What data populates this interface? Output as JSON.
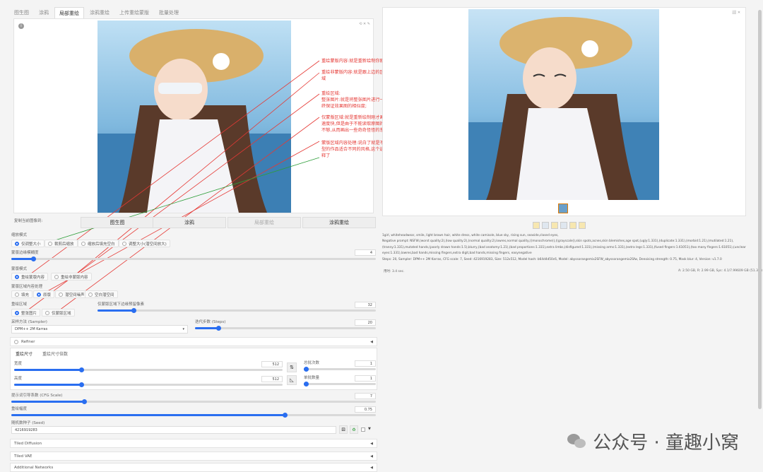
{
  "tabs": [
    "图生图",
    "涂鸦",
    "局部重绘",
    "涂鸦重绘",
    "上传重绘蒙版",
    "批量处理"
  ],
  "copy_label": "复制当前图像到:",
  "copy_buttons": [
    "图生图",
    "涂鸦",
    "局部重绘",
    "涂鸦重绘"
  ],
  "resize_mode": {
    "label": "缩放模式",
    "options": [
      "仅调整大小",
      "裁剪后缩放",
      "缩放后填充空白",
      "调整大小(潜空间放大)"
    ]
  },
  "mask_blur": {
    "label": "蒙版边缘模糊度",
    "value": "4",
    "fraction": 0.06
  },
  "mask_mode": {
    "label": "蒙版模式",
    "options": [
      "重绘蒙版内容",
      "重绘非蒙版内容"
    ]
  },
  "masked_content": {
    "label": "蒙版区域内容处理",
    "options": [
      "填充",
      "原版",
      "潜空间噪声",
      "空白潜空间"
    ]
  },
  "inpaint_area": {
    "label": "重绘区域",
    "options": [
      "整张图片",
      "仅蒙版区域"
    ]
  },
  "padding": {
    "label": "仅蒙版区域下边缘预留像素",
    "value": "32",
    "fraction": 0.13
  },
  "sampler": {
    "label": "采样方法 (Sampler)",
    "value": "DPM++ 2M Karras"
  },
  "steps": {
    "label": "迭代步数 (Steps)",
    "value": "20",
    "fraction": 0.13
  },
  "refiner": "Refiner",
  "size_tabs": [
    "重绘尺寸",
    "重绘尺寸倍数"
  ],
  "width": {
    "label": "宽度",
    "value": "512",
    "fraction": 0.25
  },
  "height": {
    "label": "高度",
    "value": "512",
    "fraction": 0.25
  },
  "batch_count": {
    "label": "总批次数",
    "value": "1",
    "fraction": 0.02
  },
  "batch_size": {
    "label": "单批数量",
    "value": "1",
    "fraction": 0.02
  },
  "cfg": {
    "label": "提示词引导系数 (CFG Scale)",
    "value": "7",
    "fraction": 0.2
  },
  "denoise": {
    "label": "重绘幅度",
    "value": "0.75",
    "fraction": 0.75
  },
  "seed": {
    "label": "随机数种子 (Seed)",
    "value": "4216919283"
  },
  "accordions": [
    "Tiled Diffusion",
    "Tiled VAE",
    "Additional Networks"
  ],
  "annotations": [
    "重绘蒙版内容:就是重新绘制你刚才画笔涂抹的区域",
    "重绘非蒙版内容:就是跟上边的区域反过来,绘制除了刚画以外的其他所有区域",
    "重绘区域:\n整张图片:就是将整张图片进行一次图生图绘制,能够读取原图的整体风格,最终保证效果图的相似度;",
    "仅蒙版区域:就是重新绘制刚才画笔涂抹的区域,与整张图相比,区域小绘制的速度快,但是由于不能读取原图的全貌,只有局部的话,就会造成对图片的认知不够,从而画出一些奇奇怪怪的东西",
    "蒙版区域内容处理:说白了就是不同的风格,这个具体的你自己尝试吧不同类型的作品适合不同的风格,这个选一个最终你满意的即可,这里就不过多的解释了"
  ],
  "output_info": {
    "prompt": "1girl, whiteheadwear, smile, light brown hair, white dress, white camisole, blue sky, rising sun, seaside,closed eyes,",
    "negative": "Negative prompt: NSFW,(worst quality:2),(low quality:2),(normal quality:2),lowres,normal quality,((monochrome)),((grayscale)),skin spots,acnes,skin blemishes,age spot,(ugly:1.331),(duplicate:1.331),(morbid:1.21),(mutilated:1.21),(tranny:1.331),mutated hands,(poorly drawn hands:1.5),blurry,(bad anatomy:1.21),(bad proportions:1.331),extra limbs,(disfigured:1.331),(missing arms:1.331),(extra legs:1.331),(fused fingers:1.61051),(too many fingers:1.61051),(unclear eyes:1.331),lowres,bad hands,missing fingers,extra digit,bad hands,missing fingers, easynegative",
    "params": "Steps: 20, Sampler: DPM++ 2M Karras, CFG scale: 7, Seed: 4216919283, Size: 512x512, Model hash: b64d4d50c6, Model: abyssorangemix2SFW_abyssorangemix2Sfw, Denoising strength: 0.75, Mask blur: 4, Version: v1.7.0",
    "time": "用时: 3.4 sec.",
    "vram": "A: 2.50 GB, R: 2.99 GB, Sys: 4.1/7.99609 GB (51.3%)"
  },
  "watermark": "公众号 · 童趣小窝",
  "colors": {
    "accent": "#2a6ef0",
    "annotation": "#e53935",
    "arrow_green": "#2e9e3a"
  }
}
